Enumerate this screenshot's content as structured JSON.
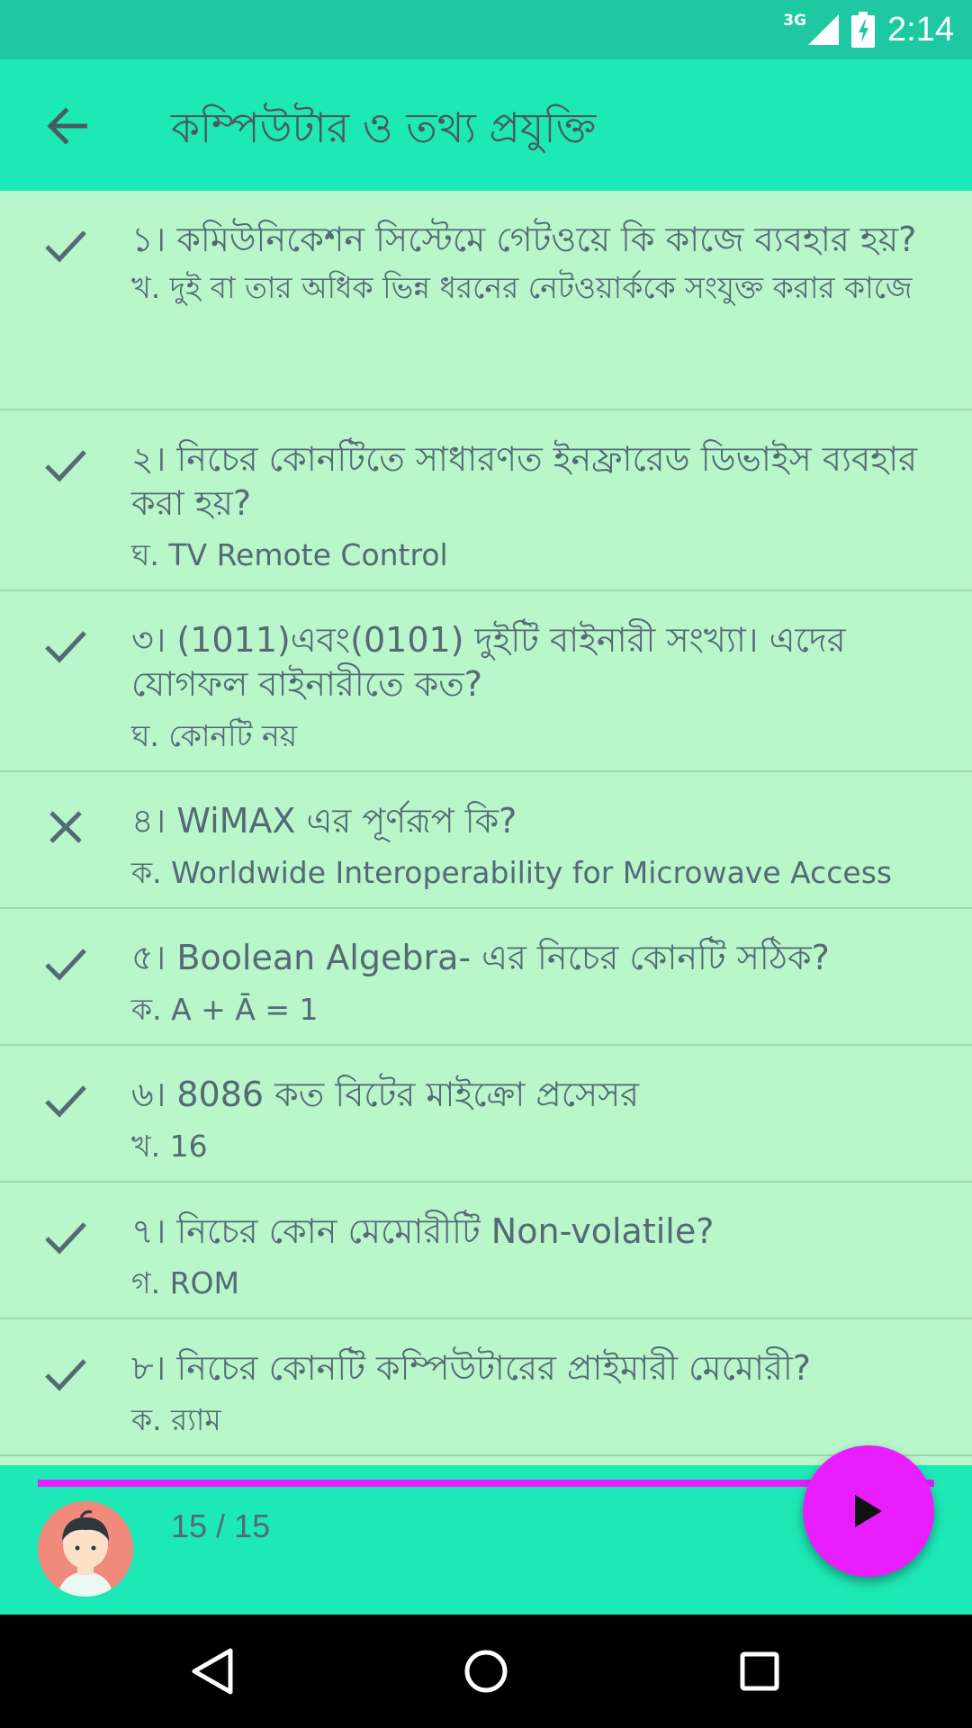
{
  "status_bar": {
    "network": "3G",
    "time": "2:14"
  },
  "app_bar": {
    "title": "কম্পিউটার ও তথ্য প্রযুক্তি"
  },
  "questions": [
    {
      "status": "correct",
      "question": "১। কমিউনিকেশন সিস্টেমে গেটওয়ে কি কাজে ব্যবহার হয়?",
      "answer": "খ. দুই বা তার অধিক ভিন্ন ধরনের নেটওয়ার্ককে সংযুক্ত করার কাজে"
    },
    {
      "status": "correct",
      "question": "২। নিচের কোনটিতে সাধারণত ইনফ্রারেড ডিভাইস ব্যবহার করা হয়?",
      "answer": "ঘ. TV Remote Control"
    },
    {
      "status": "correct",
      "question": "৩। (1011)এবং(0101) দুইটি বাইনারী সংখ্যা। এদের যোগফল বাইনারীতে কত?",
      "answer": "ঘ. কোনটি নয়"
    },
    {
      "status": "wrong",
      "question": "৪। WiMAX এর পূর্ণরূপ কি?",
      "answer": "ক. Worldwide Interoperability for Microwave Access"
    },
    {
      "status": "correct",
      "question": "৫। Boolean Algebra- এর নিচের কোনটি সঠিক?",
      "answer": "ক. A + Ā = 1"
    },
    {
      "status": "correct",
      "question": "৬। 8086 কত বিটের মাইক্রো প্রসেসর",
      "answer": "খ. 16"
    },
    {
      "status": "correct",
      "question": "৭। নিচের কোন মেমোরীটি Non-volatile?",
      "answer": "গ. ROM"
    },
    {
      "status": "correct",
      "question": "৮। নিচের কোনটি কম্পিউটারের প্রাইমারী মেমোরী?",
      "answer": "ক. র‍্যাম"
    }
  ],
  "bottom_bar": {
    "counter": "15 / 15",
    "progress": 1.0
  },
  "colors": {
    "status_bar": "#1ec9a1",
    "app_bar": "#1de9b6",
    "list_bg": "#b9f6ca",
    "accent": "#e91eff",
    "text": "#546a75"
  },
  "icons": {
    "back": "arrow-back-icon",
    "correct": "check-icon",
    "wrong": "close-icon",
    "play": "play-icon",
    "nav_back": "triangle-back-icon",
    "nav_home": "circle-home-icon",
    "nav_recents": "square-recents-icon"
  }
}
